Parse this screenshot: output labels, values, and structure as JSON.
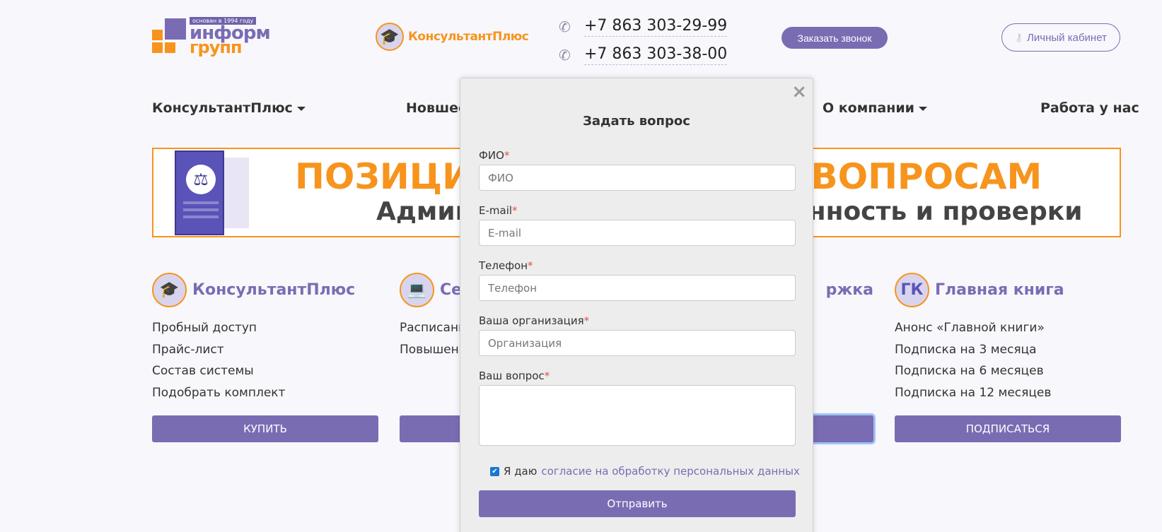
{
  "header": {
    "logo": {
      "badge": "основан в 1994 году",
      "line1": "информ",
      "line2": "групп"
    },
    "partner_logo": {
      "name": "КонсультантПлюс"
    },
    "phones": [
      "+7 863 303-29-99",
      "+7 863 303-38-00"
    ],
    "call_button": "Заказать звонок",
    "cabinet_button": "Личный кабинет"
  },
  "nav": {
    "items": [
      {
        "label": "КонсультантПлюс",
        "has_dropdown": true
      },
      {
        "label": "Новшест",
        "has_dropdown": false
      },
      {
        "label": "О компании",
        "has_dropdown": true
      },
      {
        "label": "Работа у нас",
        "has_dropdown": false
      }
    ]
  },
  "banner": {
    "headline": "ПОЗИЦИИ ПО СПОРНЫМ ВОПРОСАМ",
    "subline": "Административная ответственность и проверки"
  },
  "columns": [
    {
      "title": "КонсультантПлюс",
      "items": [
        "Пробный доступ",
        "Прайс-лист",
        "Состав системы",
        "Подобрать комплект"
      ],
      "button": "КУПИТЬ"
    },
    {
      "title": "Сем",
      "items": [
        "Расписание",
        "Повышение"
      ],
      "button": ""
    },
    {
      "title": "ржка",
      "items": [],
      "button": ""
    },
    {
      "title": "Главная книга",
      "items": [
        "Анонс «Главной книги»",
        "Подписка на 3 месяца",
        "Подписка на 6 месяцев",
        "Подписка на 12 месяцев"
      ],
      "button": "ПОДПИСАТЬСЯ"
    }
  ],
  "modal": {
    "title": "Задать вопрос",
    "close": "×",
    "fields": {
      "name": {
        "label": "ФИО",
        "placeholder": "ФИО"
      },
      "email": {
        "label": "E-mail",
        "placeholder": "E-mail"
      },
      "phone": {
        "label": "Телефон",
        "placeholder": "Телефон"
      },
      "org": {
        "label": "Ваша организация",
        "placeholder": "Организация"
      },
      "question": {
        "label": "Ваш вопрос"
      }
    },
    "required_mark": "*",
    "consent": {
      "prefix": "Я даю",
      "link": "согласие на обработку персональных данных",
      "checked": true
    },
    "submit": "Отправить"
  },
  "colors": {
    "accent": "#7a6cb3",
    "orange": "#f7941d"
  }
}
